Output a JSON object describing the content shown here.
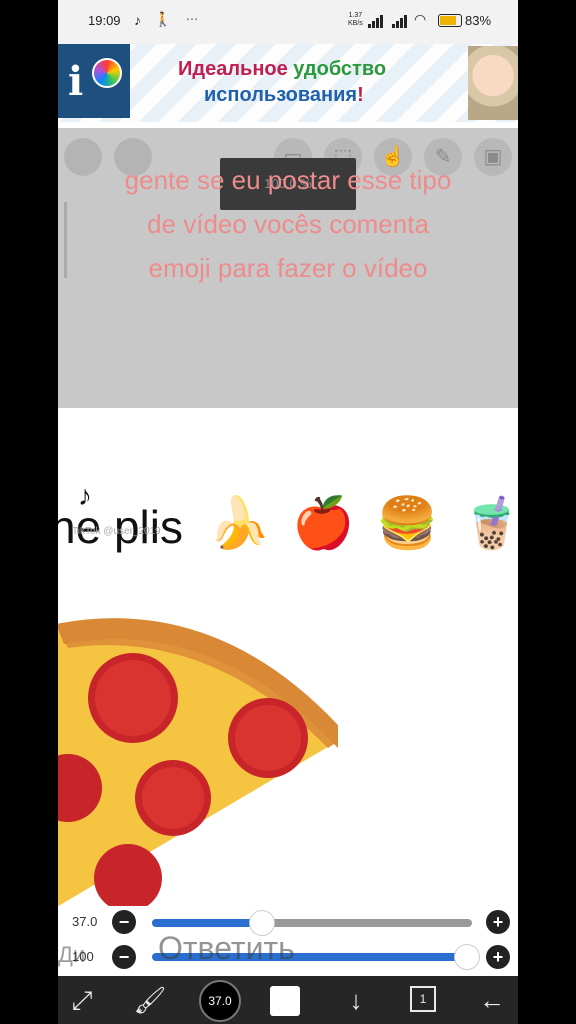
{
  "status_bar": {
    "time": "19:09",
    "speed_top": "1.37",
    "speed_bottom": "KB/s",
    "battery": "83%",
    "battery_color": "#f0b400"
  },
  "ad": {
    "line1_a": "Идеальное ",
    "line1_b": "удобство",
    "line2_a": "использования",
    "line2_b": "!"
  },
  "overlay": {
    "zoom_label": "100.0 %",
    "caption_lines": [
      "gente se eu postar esse tipo",
      "de vídeo vocês comenta",
      "emoji para fazer o vídeo"
    ]
  },
  "canvas": {
    "text": "ne plis",
    "watermark_user": "TikTok  @user_2019",
    "emojis": [
      "🍌",
      "🍎",
      "🍔",
      "🧋",
      "🍦"
    ]
  },
  "sliders": {
    "brush_size": "37.0",
    "opacity": "100",
    "brush_size_fraction": 0.34,
    "opacity_fraction": 1.0,
    "reply_hint": "Ответить",
    "reply_left": "Ди",
    "accent": "#2a6fcf"
  },
  "toolbar": {
    "brush_size_badge": "37.0",
    "layers_count": "1",
    "icons": [
      "transform-icon",
      "brush-icon",
      "brush-size-icon",
      "color-icon",
      "download-icon",
      "layers-icon",
      "back-icon"
    ]
  }
}
